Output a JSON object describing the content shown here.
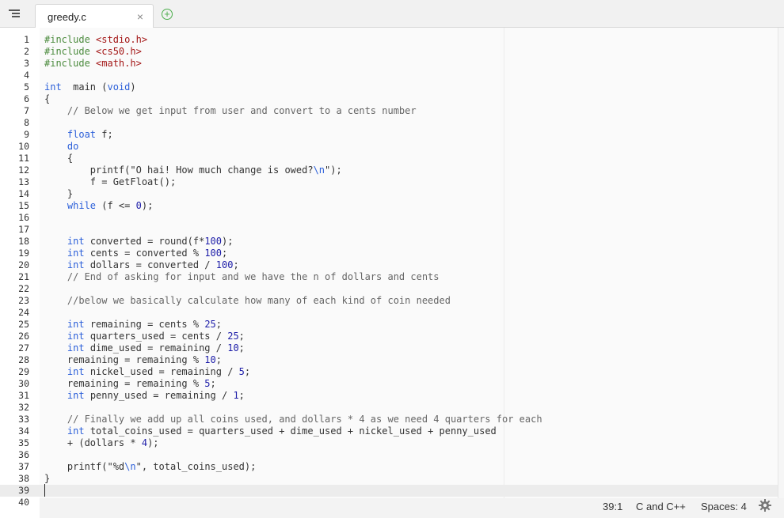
{
  "tab": {
    "title": "greedy.c",
    "close": "×",
    "new": "+"
  },
  "editor": {
    "lines": [
      {
        "n": "1",
        "t": [
          [
            "pp",
            "#include "
          ],
          [
            "inc",
            "<stdio.h>"
          ]
        ]
      },
      {
        "n": "2",
        "t": [
          [
            "pp",
            "#include "
          ],
          [
            "inc",
            "<cs50.h>"
          ]
        ]
      },
      {
        "n": "3",
        "t": [
          [
            "pp",
            "#include "
          ],
          [
            "inc",
            "<math.h>"
          ]
        ]
      },
      {
        "n": "4",
        "t": []
      },
      {
        "n": "5",
        "t": [
          [
            "kw",
            "int"
          ],
          [
            "",
            "  main ("
          ],
          [
            "kw",
            "void"
          ],
          [
            "",
            ")"
          ]
        ]
      },
      {
        "n": "6",
        "t": [
          [
            "",
            "{"
          ]
        ]
      },
      {
        "n": "7",
        "t": [
          [
            "cm",
            "    // Below we get input from user and convert to a cents number"
          ]
        ]
      },
      {
        "n": "8",
        "t": []
      },
      {
        "n": "9",
        "t": [
          [
            "",
            "    "
          ],
          [
            "kw",
            "float"
          ],
          [
            "",
            " f;"
          ]
        ]
      },
      {
        "n": "10",
        "t": [
          [
            "",
            "    "
          ],
          [
            "kw",
            "do"
          ]
        ]
      },
      {
        "n": "11",
        "t": [
          [
            "",
            "    {"
          ]
        ]
      },
      {
        "n": "12",
        "t": [
          [
            "",
            "        printf("
          ],
          [
            "str",
            "\"O hai! How much change is owed?"
          ],
          [
            "esc",
            "\\n"
          ],
          [
            "str",
            "\""
          ],
          [
            "",
            ");"
          ]
        ]
      },
      {
        "n": "13",
        "t": [
          [
            "",
            "        f = GetFloat();"
          ]
        ]
      },
      {
        "n": "14",
        "t": [
          [
            "",
            "    }"
          ]
        ]
      },
      {
        "n": "15",
        "t": [
          [
            "",
            "    "
          ],
          [
            "kw",
            "while"
          ],
          [
            "",
            " (f <= "
          ],
          [
            "num",
            "0"
          ],
          [
            "",
            ");"
          ]
        ]
      },
      {
        "n": "16",
        "t": []
      },
      {
        "n": "17",
        "t": []
      },
      {
        "n": "18",
        "t": [
          [
            "",
            "    "
          ],
          [
            "kw",
            "int"
          ],
          [
            "",
            " converted = round(f*"
          ],
          [
            "num",
            "100"
          ],
          [
            "",
            ");"
          ]
        ]
      },
      {
        "n": "19",
        "t": [
          [
            "",
            "    "
          ],
          [
            "kw",
            "int"
          ],
          [
            "",
            " cents = converted % "
          ],
          [
            "num",
            "100"
          ],
          [
            "",
            ";"
          ]
        ]
      },
      {
        "n": "20",
        "t": [
          [
            "",
            "    "
          ],
          [
            "kw",
            "int"
          ],
          [
            "",
            " dollars = converted / "
          ],
          [
            "num",
            "100"
          ],
          [
            "",
            ";"
          ]
        ]
      },
      {
        "n": "21",
        "t": [
          [
            "cm",
            "    // End of asking for input and we have the n of dollars and cents"
          ]
        ]
      },
      {
        "n": "22",
        "t": []
      },
      {
        "n": "23",
        "t": [
          [
            "cm",
            "    //below we basically calculate how many of each kind of coin needed"
          ]
        ]
      },
      {
        "n": "24",
        "t": []
      },
      {
        "n": "25",
        "t": [
          [
            "",
            "    "
          ],
          [
            "kw",
            "int"
          ],
          [
            "",
            " remaining = cents % "
          ],
          [
            "num",
            "25"
          ],
          [
            "",
            ";"
          ]
        ]
      },
      {
        "n": "26",
        "t": [
          [
            "",
            "    "
          ],
          [
            "kw",
            "int"
          ],
          [
            "",
            " quarters_used = cents / "
          ],
          [
            "num",
            "25"
          ],
          [
            "",
            ";"
          ]
        ]
      },
      {
        "n": "27",
        "t": [
          [
            "",
            "    "
          ],
          [
            "kw",
            "int"
          ],
          [
            "",
            " dime_used = remaining / "
          ],
          [
            "num",
            "10"
          ],
          [
            "",
            ";"
          ]
        ]
      },
      {
        "n": "28",
        "t": [
          [
            "",
            "    remaining = remaining % "
          ],
          [
            "num",
            "10"
          ],
          [
            "",
            ";"
          ]
        ]
      },
      {
        "n": "29",
        "t": [
          [
            "",
            "    "
          ],
          [
            "kw",
            "int"
          ],
          [
            "",
            " nickel_used = remaining / "
          ],
          [
            "num",
            "5"
          ],
          [
            "",
            ";"
          ]
        ]
      },
      {
        "n": "30",
        "t": [
          [
            "",
            "    remaining = remaining % "
          ],
          [
            "num",
            "5"
          ],
          [
            "",
            ";"
          ]
        ]
      },
      {
        "n": "31",
        "t": [
          [
            "",
            "    "
          ],
          [
            "kw",
            "int"
          ],
          [
            "",
            " penny_used = remaining / "
          ],
          [
            "num",
            "1"
          ],
          [
            "",
            ";"
          ]
        ]
      },
      {
        "n": "32",
        "t": []
      },
      {
        "n": "33",
        "t": [
          [
            "cm",
            "    // Finally we add up all coins used, and dollars * 4 as we need 4 quarters for each"
          ]
        ]
      },
      {
        "n": "34",
        "t": [
          [
            "",
            "    "
          ],
          [
            "kw",
            "int"
          ],
          [
            "",
            " total_coins_used = quarters_used + dime_used + nickel_used + penny_used"
          ]
        ]
      },
      {
        "n": "35",
        "t": [
          [
            "",
            "    + (dollars * "
          ],
          [
            "num",
            "4"
          ],
          [
            "",
            ");"
          ]
        ]
      },
      {
        "n": "36",
        "t": []
      },
      {
        "n": "37",
        "t": [
          [
            "",
            "    printf("
          ],
          [
            "str",
            "\"%d"
          ],
          [
            "esc",
            "\\n"
          ],
          [
            "str",
            "\""
          ],
          [
            "",
            ", total_coins_used);"
          ]
        ]
      },
      {
        "n": "38",
        "t": [
          [
            "",
            "}"
          ]
        ]
      },
      {
        "n": "39",
        "t": []
      },
      {
        "n": "40",
        "t": []
      }
    ]
  },
  "status": {
    "position": "39:1",
    "language": "C and C++",
    "spaces": "Spaces: 4"
  },
  "icons": {
    "menu": "menu-icon",
    "close": "close-icon",
    "new_tab": "plus-circle-icon",
    "settings": "gear-icon"
  },
  "colors": {
    "keyword": "#2b5fd9",
    "preprocessor": "#4a8a3c",
    "include_path": "#a31515",
    "comment": "#666666",
    "number": "#1c1ca8"
  }
}
